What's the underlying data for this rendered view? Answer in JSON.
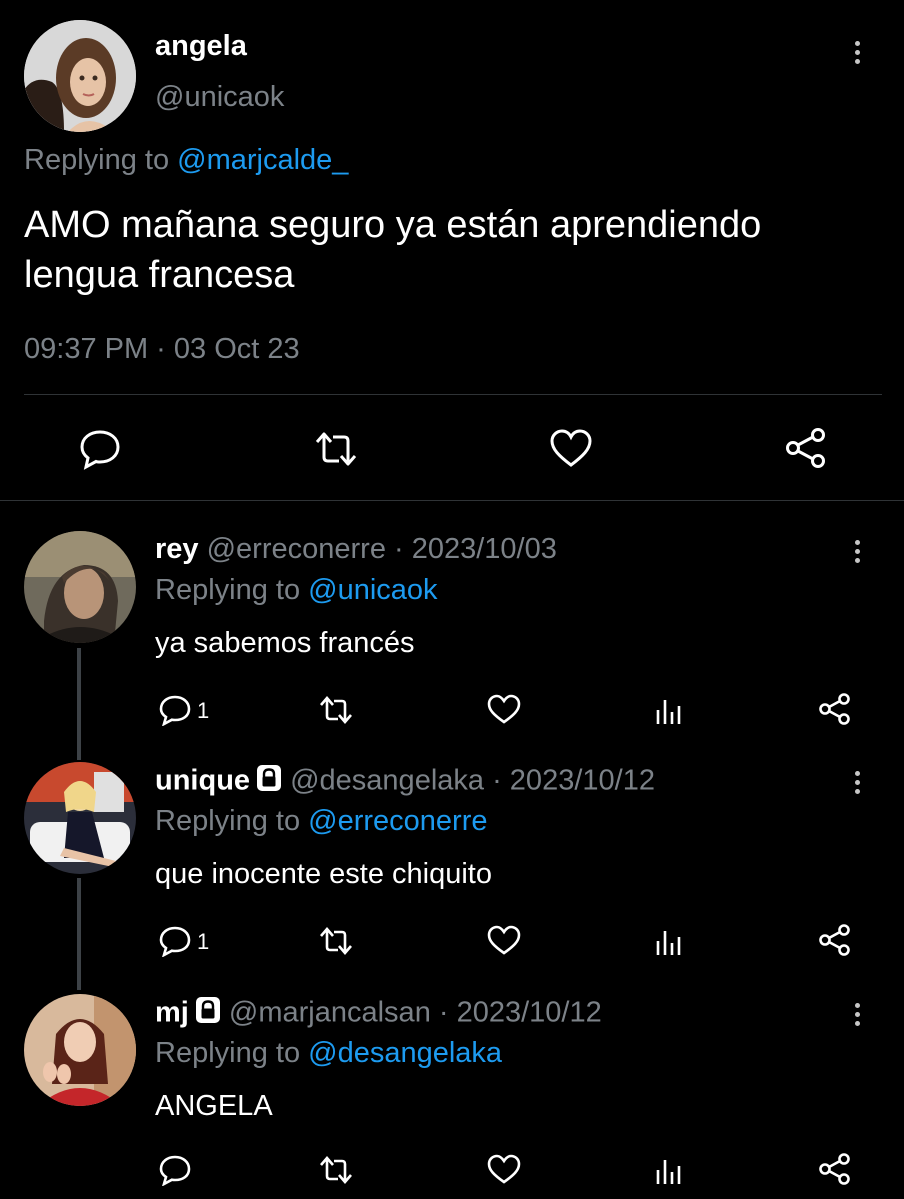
{
  "main_tweet": {
    "display_name": "angela",
    "handle": "@unicaok",
    "replying_prefix": "Replying to",
    "replying_handle": "@marjcalde_",
    "text_line1": "AMO mañana seguro ya están aprendiendo",
    "text_line2": "lengua francesa",
    "timestamp": "09:37 PM · 03 Oct 23",
    "icons": [
      "comment-icon",
      "retweet-icon",
      "heart-icon",
      "share-icon"
    ]
  },
  "replies": [
    {
      "display_name": "rey",
      "handle": "@erreconerre",
      "date": "· 2023/10/03",
      "replying_prefix": "Replying to",
      "replying_handle": "@unicaok",
      "text": "ya sabemos francés",
      "reply_count": "1",
      "locked": false
    },
    {
      "display_name": "unique",
      "handle": "@desangelaka",
      "date": "· 2023/10/12",
      "replying_prefix": "Replying to",
      "replying_handle": "@erreconerre",
      "text": "que inocente este chiquito",
      "reply_count": "1",
      "locked": true
    },
    {
      "display_name": "mj",
      "handle": "@marjancalsan",
      "date": "· 2023/10/12",
      "replying_prefix": "Replying to",
      "replying_handle": "@desangelaka",
      "text": "ANGELA",
      "reply_count": "",
      "locked": true
    }
  ],
  "colors": {
    "background": "#000000",
    "text": "#ffffff",
    "secondary": "#7c8288",
    "link": "#1d9bf0",
    "divider": "#2f3336",
    "thread_line": "#3d4247"
  }
}
